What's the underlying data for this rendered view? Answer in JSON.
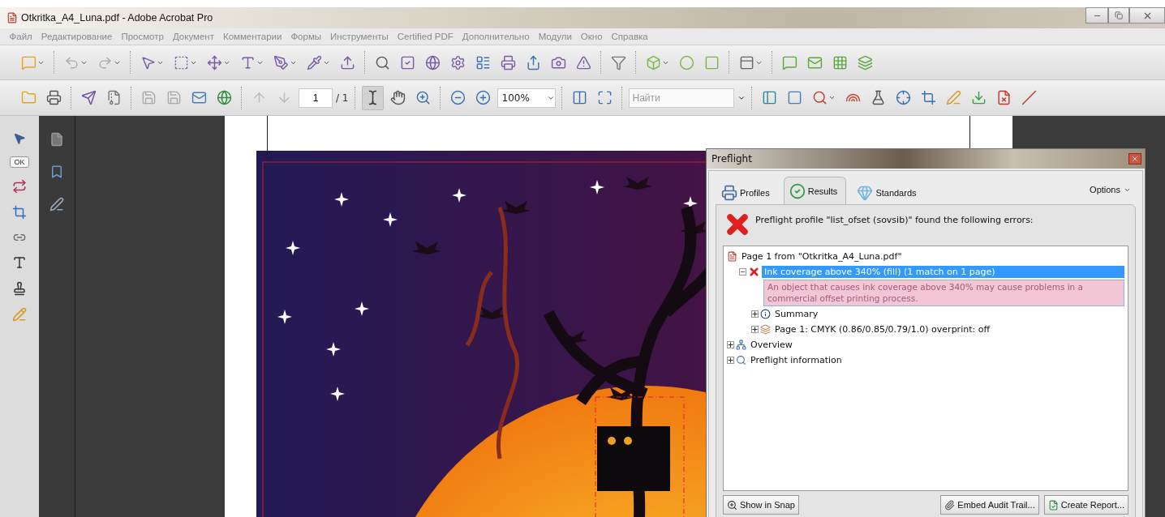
{
  "window": {
    "title": "Otkritka_A4_Luna.pdf - Adobe Acrobat Pro"
  },
  "menu": [
    "Файл",
    "Редактирование",
    "Просмотр",
    "Документ",
    "Комментарии",
    "Формы",
    "Инструменты",
    "Certified PDF",
    "Дополнительно",
    "Модули",
    "Окно",
    "Справка"
  ],
  "toolbar": {
    "page_number": "1",
    "page_total": "/ 1",
    "zoom": "100%",
    "search": {
      "placeholder": "Найти"
    }
  },
  "left_tools": {
    "ok_label": "OK"
  },
  "preflight": {
    "title": "Preflight",
    "tabs": [
      {
        "label": "Profiles",
        "kind": "profiles",
        "selected": false
      },
      {
        "label": "Results",
        "kind": "results",
        "selected": true
      },
      {
        "label": "Standards",
        "kind": "standards",
        "selected": false
      }
    ],
    "options": "Options",
    "message": "Preflight profile \"list_ofset (sovsib)\" found the following errors:",
    "tree": [
      {
        "label": "Page 1 from \"Otkritka_A4_Luna.pdf\"",
        "kind": "file",
        "children": [
          {
            "label": "Ink coverage above 340% (fill)  (1 match on 1 page)",
            "kind": "error",
            "expanded": true,
            "selected": true,
            "detail": "An object that causes ink coverage above 340% may cause problems in a commercial offset printing process.",
            "children": [
              {
                "label": "Summary",
                "kind": "summary",
                "expanded": false,
                "selected": false
              },
              {
                "label": "Page 1: CMYK (0.86/0.85/0.79/1.0)  overprint: off",
                "kind": "color",
                "expanded": false,
                "selected": false
              }
            ]
          }
        ]
      },
      {
        "label": "Overview",
        "kind": "overview",
        "expanded": false,
        "selected": false
      },
      {
        "label": "Preflight information",
        "kind": "info",
        "expanded": false,
        "selected": false
      }
    ],
    "buttons": [
      {
        "label": "Show in Snap",
        "kind": "snap"
      },
      {
        "label": "Embed Audit Trail...",
        "kind": "audit"
      },
      {
        "label": "Create Report...",
        "kind": "report"
      }
    ]
  }
}
